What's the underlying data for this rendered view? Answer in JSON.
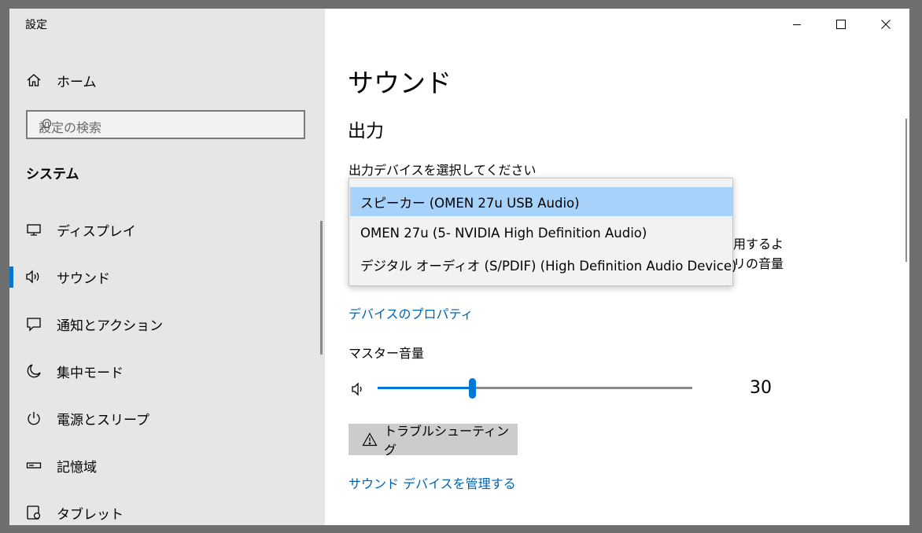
{
  "window": {
    "title": "設定"
  },
  "sidebar": {
    "home": "ホーム",
    "search_placeholder": "設定の検索",
    "section": "システム",
    "items": [
      {
        "label": "ディスプレイ",
        "icon": "monitor-icon"
      },
      {
        "label": "サウンド",
        "icon": "speaker-icon",
        "selected": true
      },
      {
        "label": "通知とアクション",
        "icon": "notification-icon"
      },
      {
        "label": "集中モード",
        "icon": "moon-icon"
      },
      {
        "label": "電源とスリープ",
        "icon": "power-icon"
      },
      {
        "label": "記憶域",
        "icon": "storage-icon"
      },
      {
        "label": "タブレット",
        "icon": "tablet-icon"
      }
    ]
  },
  "main": {
    "title": "サウンド",
    "section": "出力",
    "output_label": "出力デバイスを選択してください",
    "hidden_fragment_1": "用するよ",
    "hidden_fragment_2": "リの音量",
    "device_properties_link": "デバイスのプロパティ",
    "volume_label": "マスター音量",
    "volume_value": "30",
    "volume_level": 0.3,
    "troubleshoot_label": "トラブルシューティング",
    "manage_devices_link": "サウンド デバイスを管理する"
  },
  "dropdown": {
    "options": [
      "スピーカー (OMEN 27u USB Audio)",
      "OMEN 27u (5- NVIDIA High Definition Audio)",
      "デジタル オーディオ (S/PDIF) (High Definition Audio Device)"
    ],
    "selected_index": 0
  },
  "colors": {
    "accent": "#0078d7",
    "link": "#0063b1",
    "selection": "#a7d3fb",
    "sidebar_bg": "#e6e6e6"
  }
}
